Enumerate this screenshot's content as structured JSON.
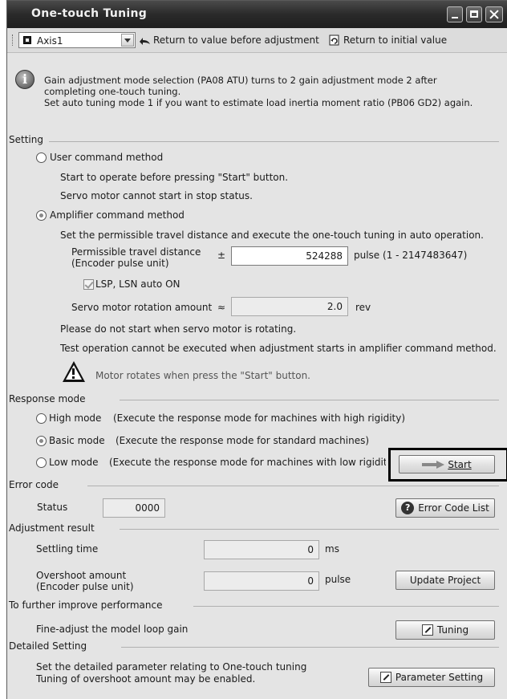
{
  "window": {
    "title": "One-touch Tuning"
  },
  "toolbar": {
    "axis_value": "Axis1",
    "return_adjust_label": "Return to value before adjustment",
    "return_initial_label": "Return to initial value"
  },
  "message": {
    "line1": "Gain adjustment mode selection (PA08 ATU) turns to 2 gain adjustment mode 2 after",
    "line2": "completing one-touch tuning.",
    "line3": "Set auto tuning mode 1 if you want to estimate load inertia moment ratio (PB06 GD2) again."
  },
  "setting": {
    "title": "Setting",
    "user_method_label": "User command method",
    "user_note1": "Start to operate before pressing \"Start\" button.",
    "user_note2": "Servo motor cannot start in stop status.",
    "amp_method_label": "Amplifier command method",
    "amp_note": "Set the permissible travel distance and execute the one-touch tuning in auto operation.",
    "travel_label1": "Permissible travel distance",
    "travel_label2": "(Encoder pulse unit)",
    "plusminus": "±",
    "travel_value": "524288",
    "travel_unit": "pulse (1 - 2147483647)",
    "lsp_label": "LSP, LSN auto ON",
    "rotation_label": "Servo motor rotation amount",
    "approx": "≈",
    "rotation_value": "2.0",
    "rotation_unit": "rev",
    "note_rotating": "Please do not start when servo motor is rotating.",
    "note_test": "Test operation cannot be executed when adjustment starts in amplifier command method.",
    "warning_text": "Motor rotates when press the \"Start\" button."
  },
  "response": {
    "title": "Response mode",
    "high_label": "High mode",
    "high_desc": "(Execute the response mode for machines with high rigidity)",
    "basic_label": "Basic mode",
    "basic_desc": "(Execute the response mode for standard machines)",
    "low_label": "Low mode",
    "low_desc": "(Execute the response mode for machines with low rigidity)",
    "start_label": "Start"
  },
  "error": {
    "title": "Error code",
    "status_label": "Status",
    "status_value": "0000",
    "list_button": "Error Code List"
  },
  "result": {
    "title": "Adjustment result",
    "settling_label": "Settling time",
    "settling_value": "0",
    "settling_unit": "ms",
    "overshoot_label1": "Overshoot amount",
    "overshoot_label2": "(Encoder pulse unit)",
    "overshoot_value": "0",
    "overshoot_unit": "pulse",
    "update_button": "Update Project"
  },
  "improve": {
    "title": "To further improve performance",
    "desc": "Fine-adjust the model loop gain",
    "tuning_button": "Tuning"
  },
  "detailed": {
    "title": "Detailed Setting",
    "desc1": "Set the detailed parameter relating to One-touch tuning",
    "desc2": "Tuning of overshoot amount may be enabled.",
    "param_button": "Parameter Setting"
  }
}
